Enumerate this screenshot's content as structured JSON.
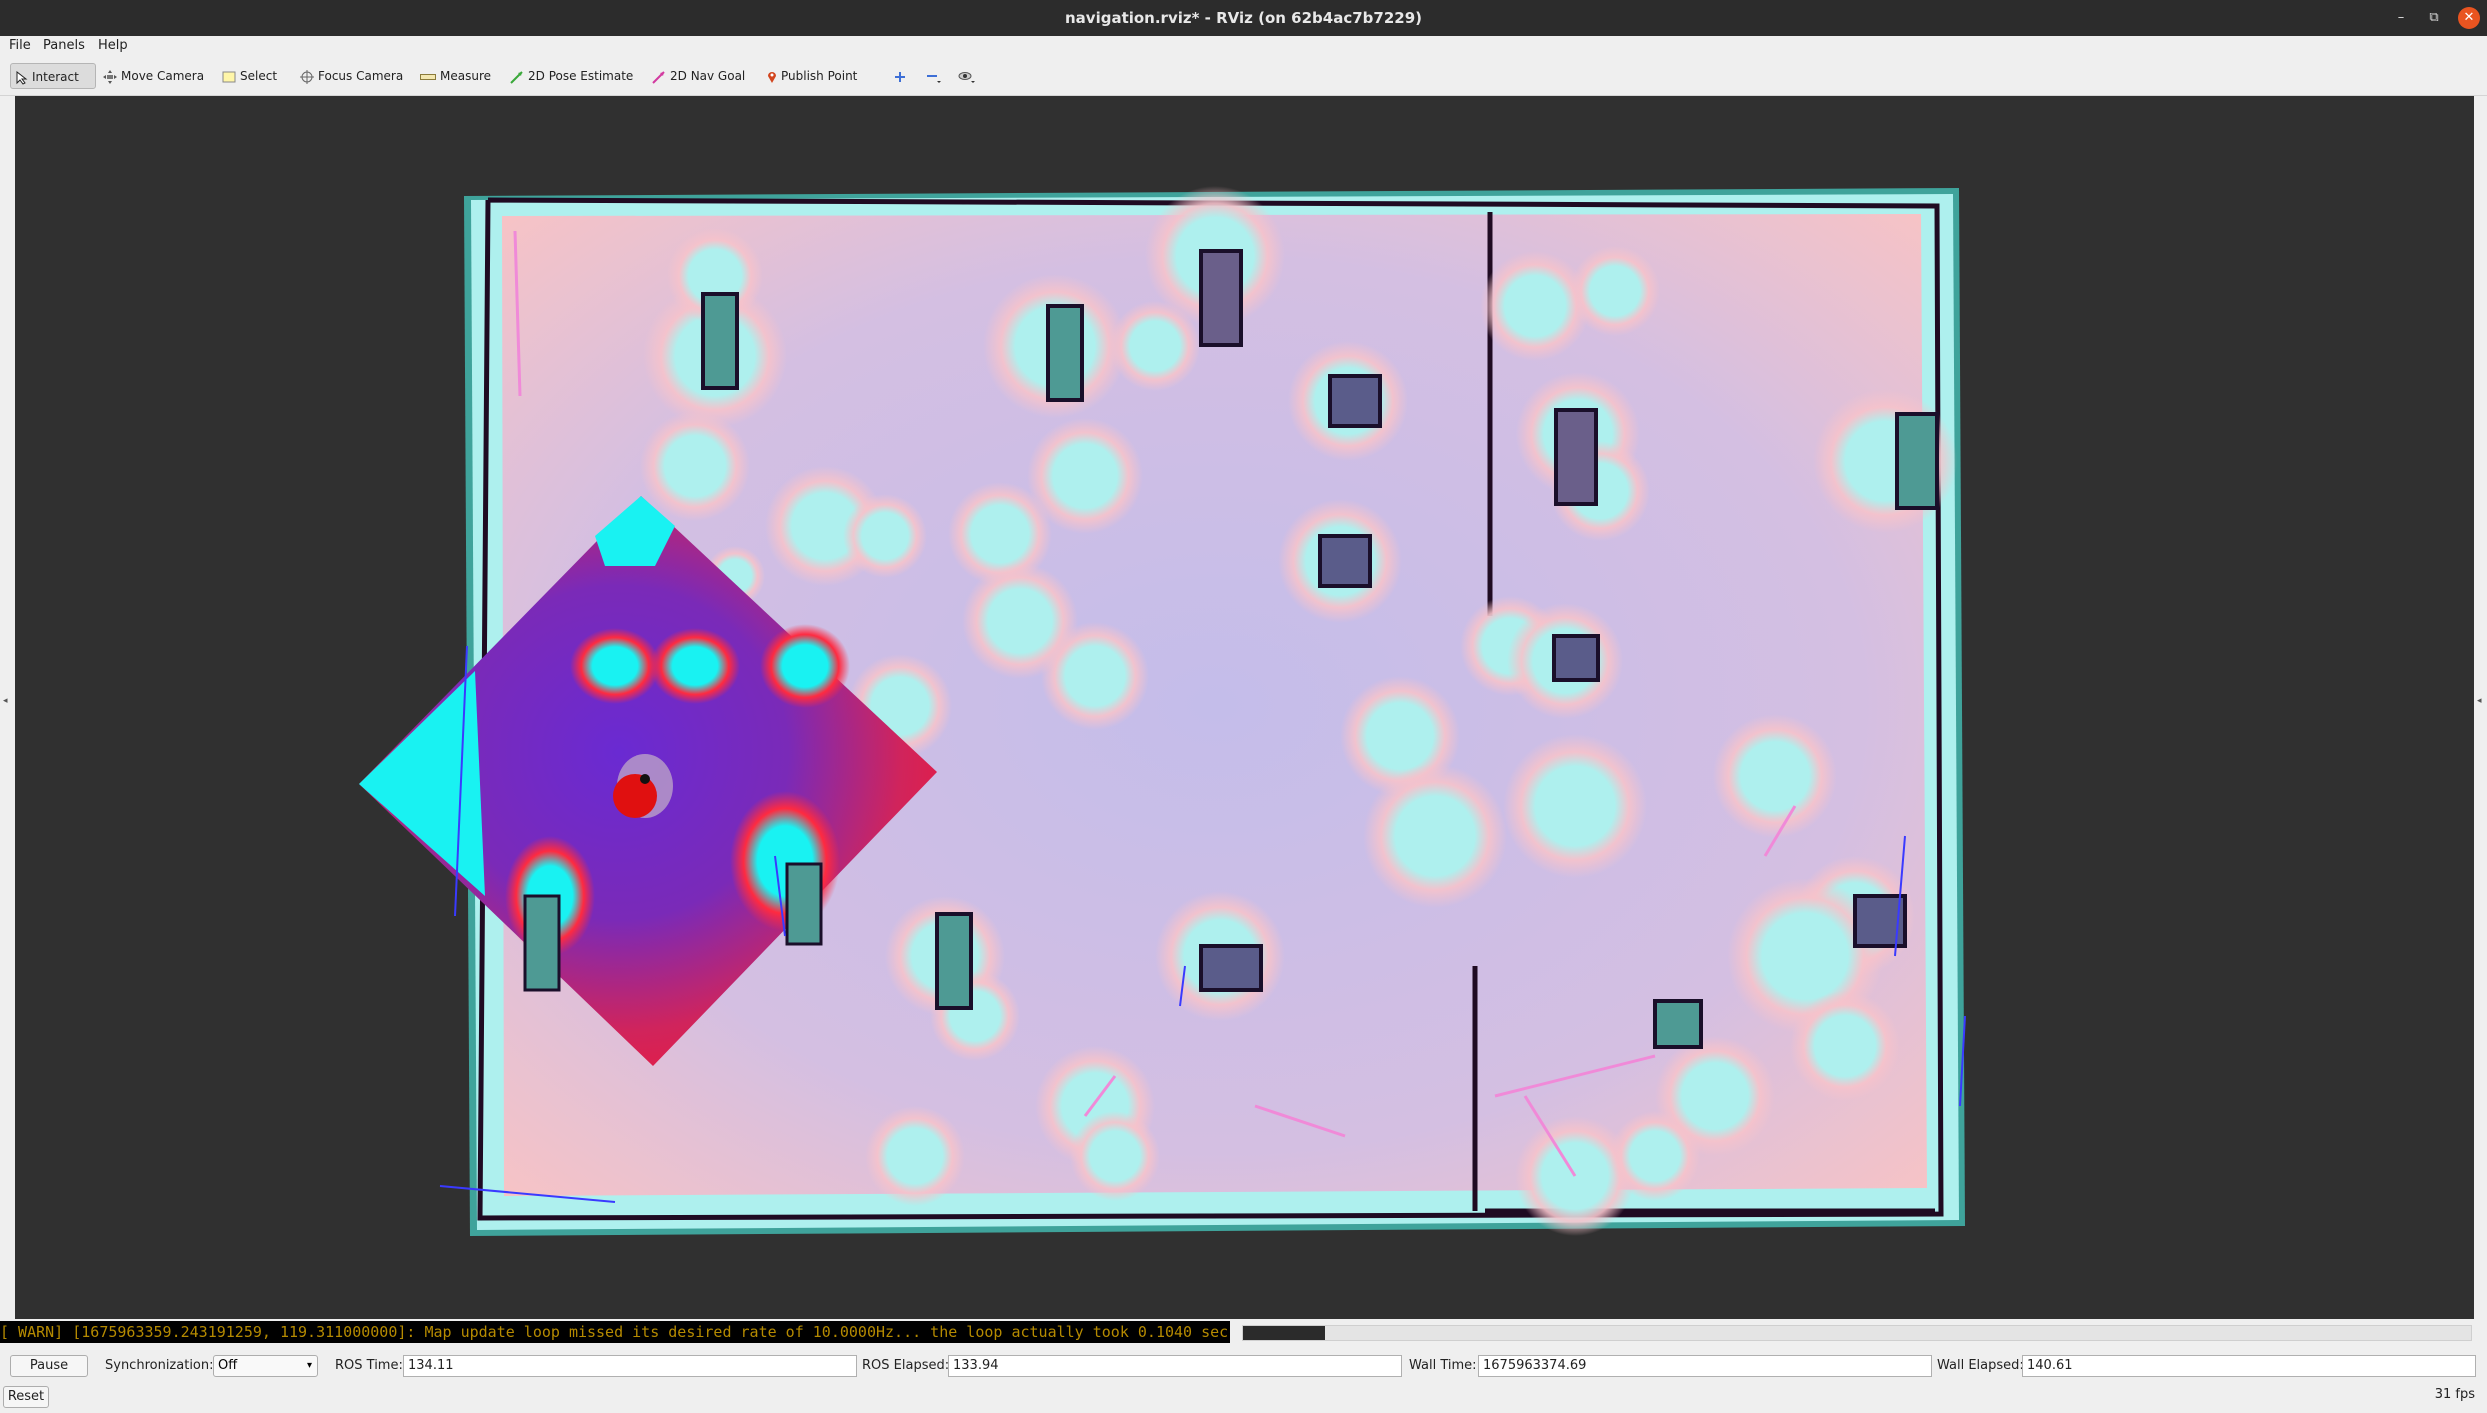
{
  "window": {
    "title": "navigation.rviz* - RViz (on 62b4ac7b7229)",
    "minimize_glyph": "–",
    "maximize_glyph": "⧉",
    "close_glyph": "✕"
  },
  "menu": [
    "File",
    "Panels",
    "Help"
  ],
  "toolbar": {
    "tools": [
      {
        "label": "Interact",
        "icon": "cursor-icon",
        "active": true
      },
      {
        "label": "Move Camera",
        "icon": "move-camera-icon"
      },
      {
        "label": "Select",
        "icon": "select-icon"
      },
      {
        "label": "Focus Camera",
        "icon": "focus-camera-icon"
      },
      {
        "label": "Measure",
        "icon": "ruler-icon"
      },
      {
        "label": "2D Pose Estimate",
        "icon": "green-arrow-icon"
      },
      {
        "label": "2D Nav Goal",
        "icon": "pink-arrow-icon"
      },
      {
        "label": "Publish Point",
        "icon": "map-pin-icon"
      }
    ],
    "extra_icons": [
      "add-tool-icon",
      "remove-tool-icon",
      "camera-type-icon"
    ]
  },
  "colors": {
    "background": "#303030",
    "costmap_free": "#c6bde6",
    "inflation_halo": "#f5c4c8",
    "inscribed": "#aef0ee",
    "obstacle_fill": "#4e9a94",
    "wall": "#1f0b22",
    "local_costmap_edge": "#1ff5f5",
    "local_costmap_core": "#7028c8",
    "robot": "#e01010"
  },
  "console": {
    "warning": "[ WARN] [1675963359.243191259, 119.311000000]: Map update loop missed its desired rate of 10.0000Hz... the loop actually took 0.1040 sec"
  },
  "time_panel": {
    "pause_label": "Pause",
    "sync_label": "Synchronization:",
    "sync_value": "Off",
    "ros_time_label": "ROS Time:",
    "ros_time": "134.11",
    "ros_elapsed_label": "ROS Elapsed:",
    "ros_elapsed": "133.94",
    "wall_time_label": "Wall Time:",
    "wall_time": "1675963374.69",
    "wall_elapsed_label": "Wall Elapsed:",
    "wall_elapsed": "140.61"
  },
  "bottom": {
    "reset_label": "Reset",
    "fps": "31 fps"
  }
}
